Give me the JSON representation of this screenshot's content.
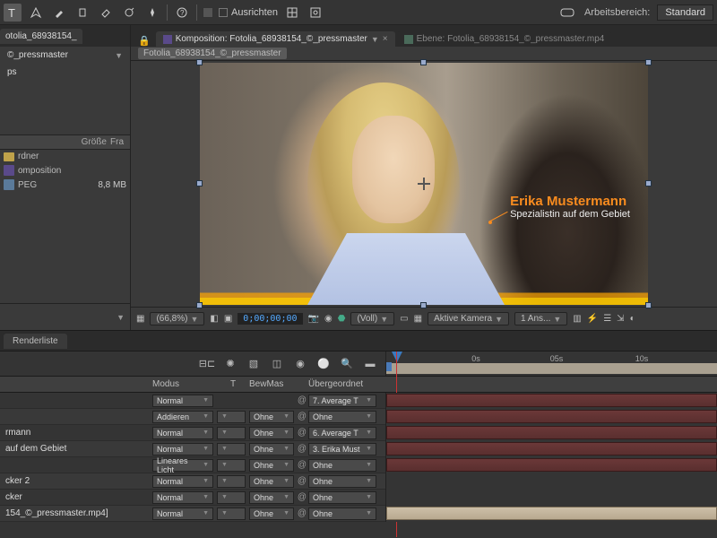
{
  "toolbar": {
    "align_label": "Ausrichten",
    "workspace_label": "Arbeitsbereich:",
    "workspace_value": "Standard"
  },
  "project": {
    "tab": "otolia_68938154_",
    "sub": "©_pressmaster",
    "ps": "ps",
    "hdr_size": "Größe",
    "hdr_frame": "Fra",
    "rows": {
      "r0": "rdner",
      "r1": "omposition",
      "r2": "PEG",
      "r2_size": "8,8 MB"
    }
  },
  "comp": {
    "header1": "Komposition: Fotolia_68938154_©_pressmaster",
    "header2": "Ebene: Fotolia_68938154_©_pressmaster.mp4",
    "crumb": "Fotolia_68938154_©_pressmaster",
    "lt_name": "Erika Mustermann",
    "lt_sub": "Spezialistin auf dem Gebiet"
  },
  "viewer": {
    "zoom": "(66,8%)",
    "timecode": "0;00;00;00",
    "res": "(Voll)",
    "cam": "Aktive Kamera",
    "views": "1 Ans..."
  },
  "render_queue": {
    "tab": "Renderliste"
  },
  "timeline": {
    "ruler": {
      "t0": "0s",
      "t1": "05s",
      "t2": "10s"
    },
    "cols": {
      "mode": "Modus",
      "t": "T",
      "trk": "BewMas",
      "parent": "Übergeordnet"
    },
    "modes": {
      "normal": "Normal",
      "add": "Addieren",
      "linear": "Lineares Licht"
    },
    "trk_none": "Ohne",
    "parents": {
      "p7": "7. Average T",
      "p6": "6. Average T",
      "p3": "3. Erika Must",
      "none": "Ohne"
    },
    "layers": {
      "l0": "",
      "l1": "rmann",
      "l2": "auf dem Gebiet",
      "l3": "",
      "l4": "cker 2",
      "l5": "cker",
      "l6": "154_©_pressmaster.mp4]"
    }
  }
}
